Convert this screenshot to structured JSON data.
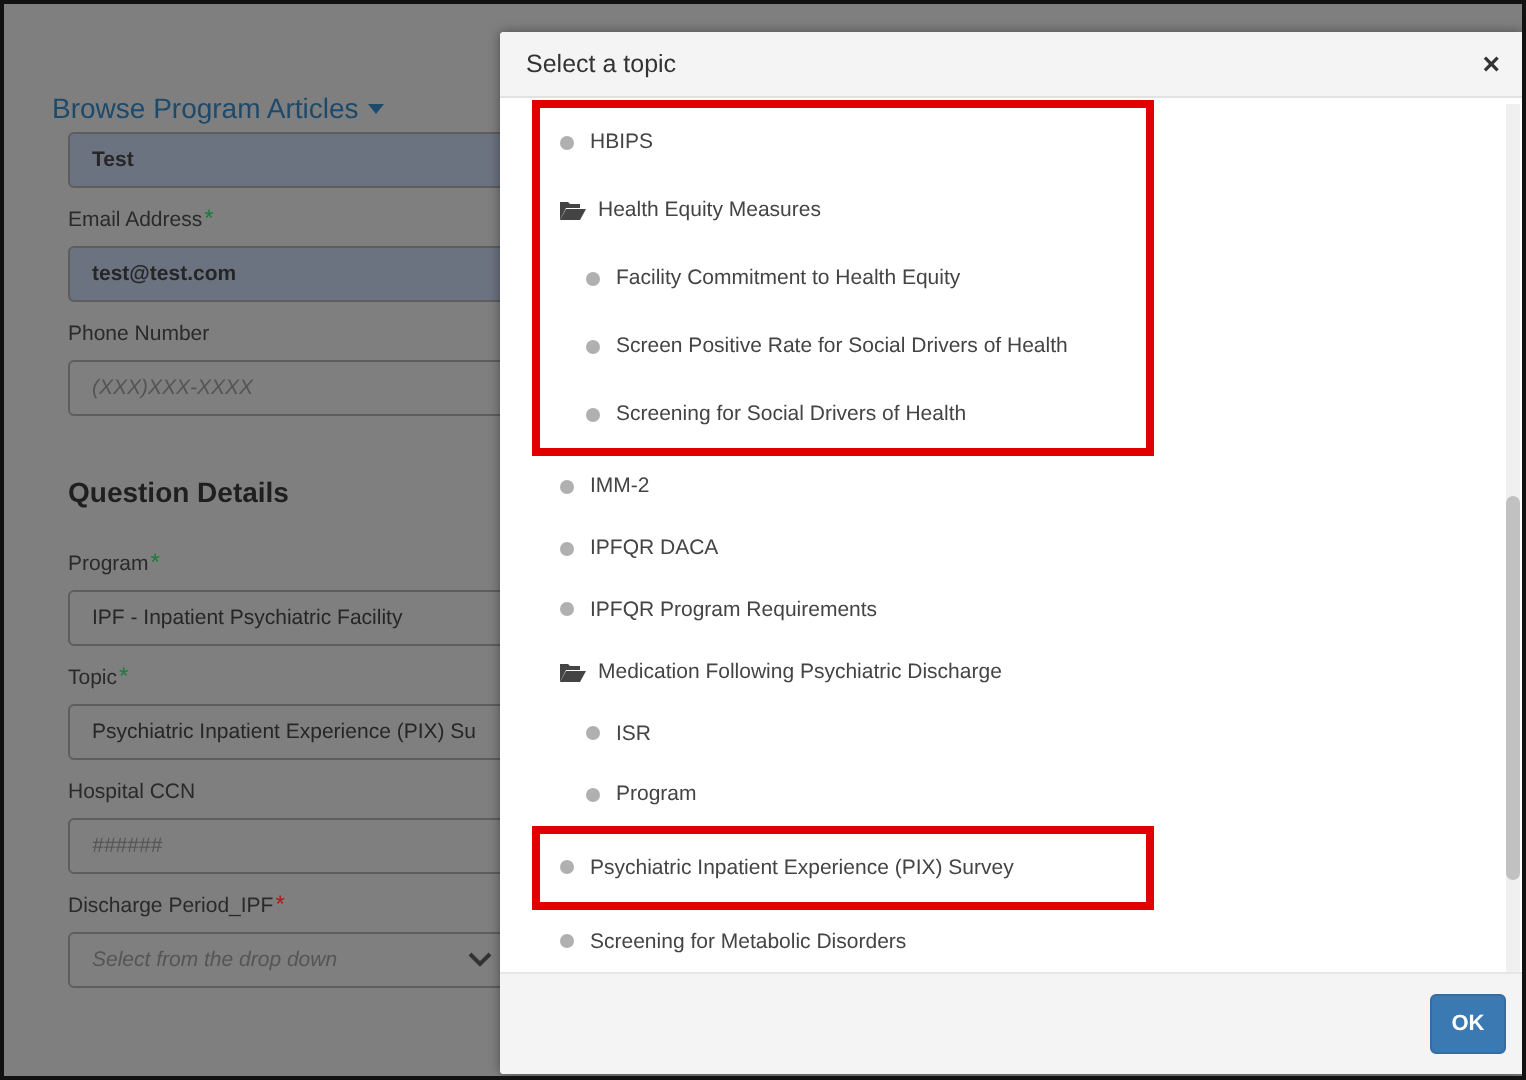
{
  "page": {
    "browse_link": "Browse Program Articles",
    "fields": [
      {
        "value": "Test",
        "filled": true
      },
      {
        "label": "Email Address",
        "required_mark": "*",
        "color": "#1e7a3c",
        "value": "test@test.com",
        "filled": true
      },
      {
        "label": "Phone Number",
        "placeholder": "(XXX)XXX-XXXX",
        "filled": false
      },
      {
        "kind": "heading",
        "label": "Question Details"
      },
      {
        "label": "Program",
        "required_mark": "*",
        "color": "#1e7a3c",
        "value": "IPF - Inpatient Psychiatric Facility",
        "filled": false
      },
      {
        "label": "Topic",
        "required_mark": "*",
        "color": "#1e7a3c",
        "value": "Psychiatric Inpatient Experience (PIX) Su",
        "filled": false
      },
      {
        "label": "Hospital CCN",
        "placeholder": "######",
        "filled": false
      },
      {
        "label": "Discharge Period_IPF",
        "required_mark": "*",
        "color": "#b01818",
        "placeholder": "Select from the drop down",
        "filled": false,
        "dropdown": true
      }
    ]
  },
  "dialog": {
    "title": "Select a topic",
    "close": "×",
    "ok_button": "OK",
    "topics": [
      {
        "kind": "leaf",
        "label": "HBIPS",
        "highlighted": true
      },
      {
        "kind": "folder",
        "label": "Health Equity Measures",
        "expanded": true,
        "highlighted": true,
        "children": [
          {
            "kind": "leaf",
            "label": "Facility Commitment to Health Equity"
          },
          {
            "kind": "leaf",
            "label": "Screen Positive Rate for Social Drivers of Health"
          },
          {
            "kind": "leaf",
            "label": "Screening for Social Drivers of Health"
          }
        ]
      },
      {
        "kind": "leaf",
        "label": "IMM-2",
        "highlighted": false
      },
      {
        "kind": "leaf",
        "label": "IPFQR DACA",
        "highlighted": false
      },
      {
        "kind": "leaf",
        "label": "IPFQR Program Requirements",
        "highlighted": false
      },
      {
        "kind": "folder",
        "label": "Medication Following Psychiatric Discharge",
        "expanded": true,
        "highlighted": false,
        "children": [
          {
            "kind": "leaf",
            "label": "ISR"
          },
          {
            "kind": "leaf",
            "label": "Program"
          }
        ]
      },
      {
        "kind": "leaf",
        "label": "Psychiatric Inpatient Experience (PIX) Survey",
        "highlighted": true
      },
      {
        "kind": "leaf",
        "label": "Screening for Metabolic Disorders",
        "highlighted": false
      }
    ]
  }
}
